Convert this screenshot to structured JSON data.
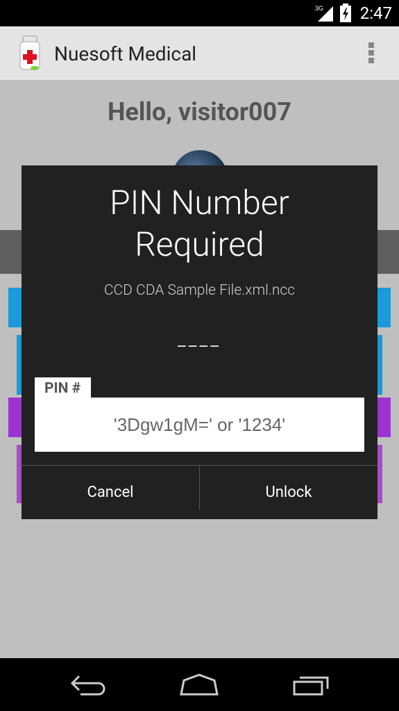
{
  "status_bar": {
    "network": "3G",
    "time": "2:47"
  },
  "action_bar": {
    "title": "Nuesoft Medical",
    "app_icon": "medicine-bottle-icon",
    "overflow_icon": "overflow-menu-icon"
  },
  "background": {
    "greeting": "Hello, visitor007"
  },
  "dialog": {
    "title": "PIN Number\nRequired",
    "file_name": "CCD CDA Sample File.xml.ncc",
    "pin_mask": "____",
    "pin_label": "PIN #",
    "pin_placeholder": "'3Dgw1gM=' or '1234'",
    "cancel_label": "Cancel",
    "unlock_label": "Unlock"
  },
  "nav_bar": {
    "back_icon": "back-icon",
    "home_icon": "home-icon",
    "recents_icon": "recents-icon"
  },
  "colors": {
    "dialog_bg": "#212121",
    "actionbar_bg": "#e4e4e4",
    "blue_tile": "#1a9ad8",
    "purple_tile": "#9c34d0"
  }
}
